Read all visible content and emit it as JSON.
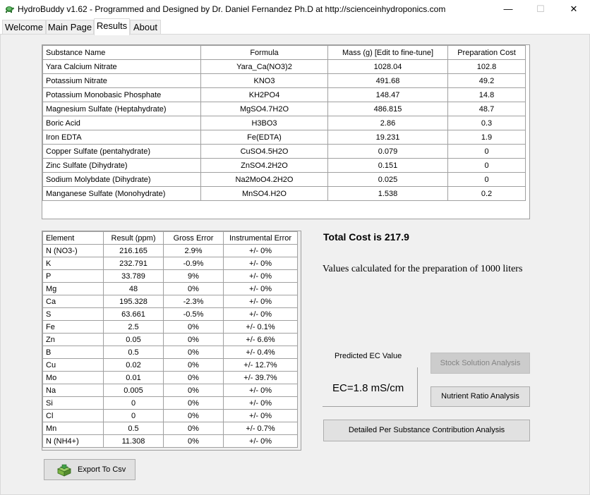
{
  "window": {
    "title": "HydroBuddy v1.62 - Programmed and Designed by Dr. Daniel Fernandez Ph.D at http://scienceinhydroponics.com",
    "controls": {
      "minimize": "—",
      "maximize": "☐",
      "close": "✕"
    }
  },
  "tabs": [
    {
      "label": "Welcome"
    },
    {
      "label": "Main Page"
    },
    {
      "label": "Results"
    },
    {
      "label": "About"
    }
  ],
  "substances": {
    "columns": [
      "Substance Name",
      "Formula",
      "Mass (g) [Edit to fine-tune]",
      "Preparation Cost"
    ],
    "rows": [
      [
        "Yara Calcium Nitrate",
        "Yara_Ca(NO3)2",
        "1028.04",
        "102.8"
      ],
      [
        "Potassium Nitrate",
        "KNO3",
        "491.68",
        "49.2"
      ],
      [
        "Potassium Monobasic Phosphate",
        "KH2PO4",
        "148.47",
        "14.8"
      ],
      [
        "Magnesium Sulfate (Heptahydrate)",
        "MgSO4.7H2O",
        "486.815",
        "48.7"
      ],
      [
        "Boric Acid",
        "H3BO3",
        "2.86",
        "0.3"
      ],
      [
        "Iron EDTA",
        "Fe(EDTA)",
        "19.231",
        "1.9"
      ],
      [
        "Copper Sulfate (pentahydrate)",
        "CuSO4.5H2O",
        "0.079",
        "0"
      ],
      [
        "Zinc Sulfate (Dihydrate)",
        "ZnSO4.2H2O",
        "0.151",
        "0"
      ],
      [
        "Sodium Molybdate (Dihydrate)",
        "Na2MoO4.2H2O",
        "0.025",
        "0"
      ],
      [
        "Manganese Sulfate (Monohydrate)",
        "MnSO4.H2O",
        "1.538",
        "0.2"
      ]
    ]
  },
  "elements": {
    "columns": [
      "Element",
      "Result (ppm)",
      "Gross Error",
      "Instrumental Error"
    ],
    "rows": [
      [
        "N (NO3-)",
        "216.165",
        "2.9%",
        "+/- 0%"
      ],
      [
        "K",
        "232.791",
        "-0.9%",
        "+/- 0%"
      ],
      [
        "P",
        "33.789",
        "9%",
        "+/- 0%"
      ],
      [
        "Mg",
        "48",
        "0%",
        "+/- 0%"
      ],
      [
        "Ca",
        "195.328",
        "-2.3%",
        "+/- 0%"
      ],
      [
        "S",
        "63.661",
        "-0.5%",
        "+/- 0%"
      ],
      [
        "Fe",
        "2.5",
        "0%",
        "+/- 0.1%"
      ],
      [
        "Zn",
        "0.05",
        "0%",
        "+/- 6.6%"
      ],
      [
        "B",
        "0.5",
        "0%",
        "+/- 0.4%"
      ],
      [
        "Cu",
        "0.02",
        "0%",
        "+/- 12.7%"
      ],
      [
        "Mo",
        "0.01",
        "0%",
        "+/- 39.7%"
      ],
      [
        "Na",
        "0.005",
        "0%",
        "+/- 0%"
      ],
      [
        "Si",
        "0",
        "0%",
        "+/- 0%"
      ],
      [
        "Cl",
        "0",
        "0%",
        "+/- 0%"
      ],
      [
        "Mn",
        "0.5",
        "0%",
        "+/- 0.7%"
      ],
      [
        "N (NH4+)",
        "11.308",
        "0%",
        "+/- 0%"
      ]
    ]
  },
  "summary": {
    "total_cost": "Total Cost is 217.9",
    "values_note": "Values calculated for the preparation of 1000 liters",
    "ec_label": "Predicted EC Value",
    "ec_value": "EC=1.8 mS/cm"
  },
  "buttons": {
    "stock": "Stock Solution Analysis",
    "ratio": "Nutrient Ratio Analysis",
    "detail": "Detailed Per Substance Contribution Analysis",
    "export": "Export To Csv"
  },
  "icons": {
    "app": "turtle-icon",
    "export": "export-box-icon"
  }
}
